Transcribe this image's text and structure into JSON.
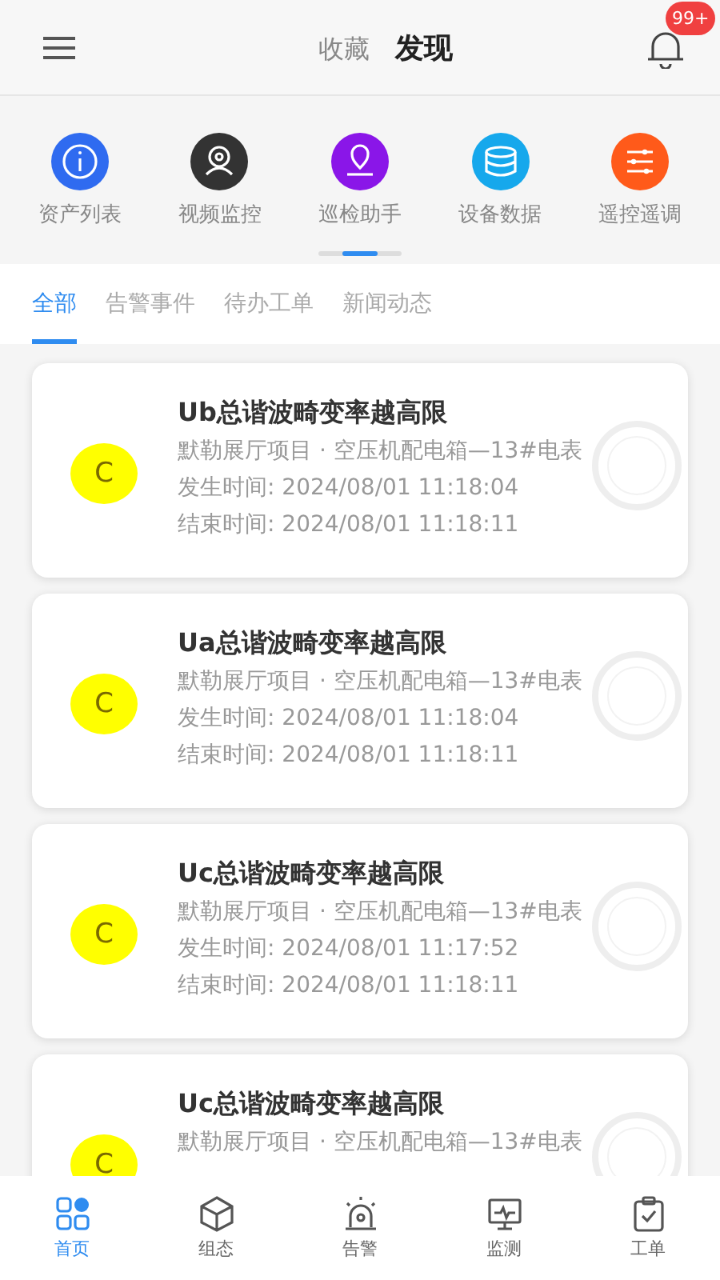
{
  "header": {
    "tabs": [
      {
        "label": "收藏",
        "selected": false
      },
      {
        "label": "发现",
        "selected": true
      }
    ],
    "badge": "99+"
  },
  "quick_actions": [
    {
      "label": "资产列表",
      "color": "#2f6bf0"
    },
    {
      "label": "视频监控",
      "color": "#333333"
    },
    {
      "label": "巡检助手",
      "color": "#8a16e8"
    },
    {
      "label": "设备数据",
      "color": "#16a8ec"
    },
    {
      "label": "遥控遥调",
      "color": "#ff5a1a"
    }
  ],
  "filter_tabs": [
    {
      "label": "全部",
      "selected": true
    },
    {
      "label": "告警事件",
      "selected": false
    },
    {
      "label": "待办工单",
      "selected": false
    },
    {
      "label": "新闻动态",
      "selected": false
    }
  ],
  "alarms": [
    {
      "level": "C",
      "color": "#ffff00",
      "title": "Ub总谐波畸变率越高限",
      "source": "默勒展厅项目 · 空压机配电箱—13#电表",
      "lines": [
        "发生时间: 2024/08/01 11:18:04",
        "结束时间: 2024/08/01 11:18:11"
      ]
    },
    {
      "level": "C",
      "color": "#ffff00",
      "title": "Ua总谐波畸变率越高限",
      "source": "默勒展厅项目 · 空压机配电箱—13#电表",
      "lines": [
        "发生时间: 2024/08/01 11:18:04",
        "结束时间: 2024/08/01 11:18:11"
      ]
    },
    {
      "level": "C",
      "color": "#ffff00",
      "title": "Uc总谐波畸变率越高限",
      "source": "默勒展厅项目 · 空压机配电箱—13#电表",
      "lines": [
        "发生时间: 2024/08/01 11:17:52",
        "结束时间: 2024/08/01 11:18:11"
      ]
    },
    {
      "level": "C",
      "color": "#ffff00",
      "title": "Uc总谐波畸变率越高限",
      "source": "默勒展厅项目 · 空压机配电箱—13#电表"
    }
  ],
  "bottom_nav": [
    {
      "label": "首页",
      "selected": true
    },
    {
      "label": "组态",
      "selected": false
    },
    {
      "label": "告警",
      "selected": false
    },
    {
      "label": "监测",
      "selected": false
    },
    {
      "label": "工单",
      "selected": false
    }
  ]
}
